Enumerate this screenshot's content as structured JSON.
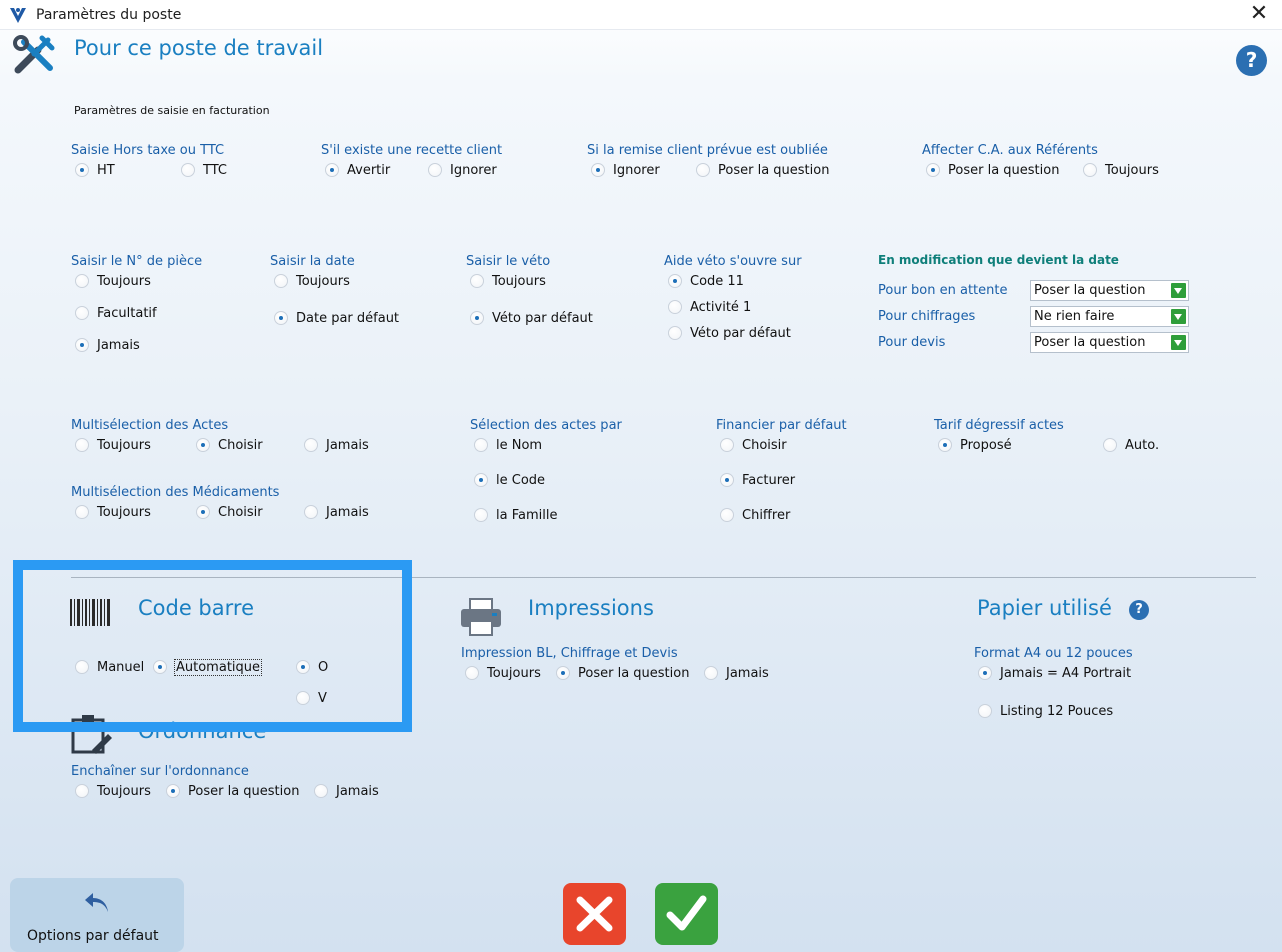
{
  "window": {
    "title": "Paramètres du poste"
  },
  "header": {
    "title": "Pour ce poste de travail",
    "subtitle": "Paramètres de saisie en facturation",
    "help": "?"
  },
  "saisie_ht_ttc": {
    "label": "Saisie Hors taxe ou TTC",
    "options": [
      "HT",
      "TTC"
    ],
    "selected": "HT"
  },
  "recette_client": {
    "label": "S'il existe une recette client",
    "options": [
      "Avertir",
      "Ignorer"
    ],
    "selected": "Avertir"
  },
  "remise_client": {
    "label": "Si la remise client prévue est oubliée",
    "options": [
      "Ignorer",
      "Poser la question"
    ],
    "selected": "Ignorer"
  },
  "affecter_ca": {
    "label": "Affecter C.A. aux Référents",
    "options": [
      "Poser la question",
      "Toujours"
    ],
    "selected": "Poser la question"
  },
  "numero_piece": {
    "label": "Saisir le N° de pièce",
    "options": [
      "Toujours",
      "Facultatif",
      "Jamais"
    ],
    "selected": "Jamais"
  },
  "saisir_date": {
    "label": "Saisir la date",
    "options": [
      "Toujours",
      "Date par défaut"
    ],
    "selected": "Date par défaut"
  },
  "saisir_veto": {
    "label": "Saisir le véto",
    "options": [
      "Toujours",
      "Véto par défaut"
    ],
    "selected": "Véto par défaut"
  },
  "aide_veto": {
    "label": "Aide véto s'ouvre sur",
    "options": [
      "Code 11",
      "Activité 1",
      "Véto par défaut"
    ],
    "selected": "Code 11"
  },
  "modification_date": {
    "label": "En modification que devient  la date",
    "rows": [
      {
        "label": "Pour bon en attente",
        "value": "Poser la question"
      },
      {
        "label": "Pour chiffrages",
        "value": "Ne rien faire"
      },
      {
        "label": "Pour devis",
        "value": "Poser la question"
      }
    ]
  },
  "multiselection_actes": {
    "label": "Multisélection des  Actes",
    "options": [
      "Toujours",
      "Choisir",
      "Jamais"
    ],
    "selected": "Choisir"
  },
  "multiselection_medicaments": {
    "label": "Multisélection des Médicaments",
    "options": [
      "Toujours",
      "Choisir",
      "Jamais"
    ],
    "selected": "Choisir"
  },
  "selection_actes": {
    "label": "Sélection des actes par",
    "options": [
      "le Nom",
      "le Code",
      "la Famille"
    ],
    "selected": "le Code"
  },
  "financier": {
    "label": "Financier par défaut",
    "options": [
      "Choisir",
      "Facturer",
      "Chiffrer"
    ],
    "selected": "Facturer"
  },
  "tarif_degressif": {
    "label": "Tarif dégressif actes",
    "options": [
      "Proposé",
      "Auto."
    ],
    "selected": "Proposé"
  },
  "code_barre": {
    "title": "Code barre",
    "options": [
      "Manuel",
      "Automatique"
    ],
    "selected": "Automatique",
    "sub_options": [
      "O",
      "V"
    ],
    "sub_selected": "O"
  },
  "ordonnance": {
    "title": "Ordonnance",
    "label": "Enchaîner sur l'ordonnance",
    "options": [
      "Toujours",
      "Poser la question",
      "Jamais"
    ],
    "selected": "Poser la question"
  },
  "impressions": {
    "title": "Impressions",
    "label": "Impression BL, Chiffrage et Devis",
    "options": [
      "Toujours",
      "Poser la question",
      "Jamais"
    ],
    "selected": "Poser la question"
  },
  "papier": {
    "title": "Papier utilisé",
    "label": "Format A4 ou 12 pouces",
    "options": [
      "Jamais = A4 Portrait",
      "Listing  12 Pouces"
    ],
    "selected": "Jamais = A4 Portrait",
    "help": "?"
  },
  "footer": {
    "defaults_label": "Options par défaut"
  },
  "colors": {
    "accent": "#1a7fc1",
    "highlight": "#2b9af3",
    "cancel": "#e8452c",
    "ok": "#3aa23f"
  }
}
